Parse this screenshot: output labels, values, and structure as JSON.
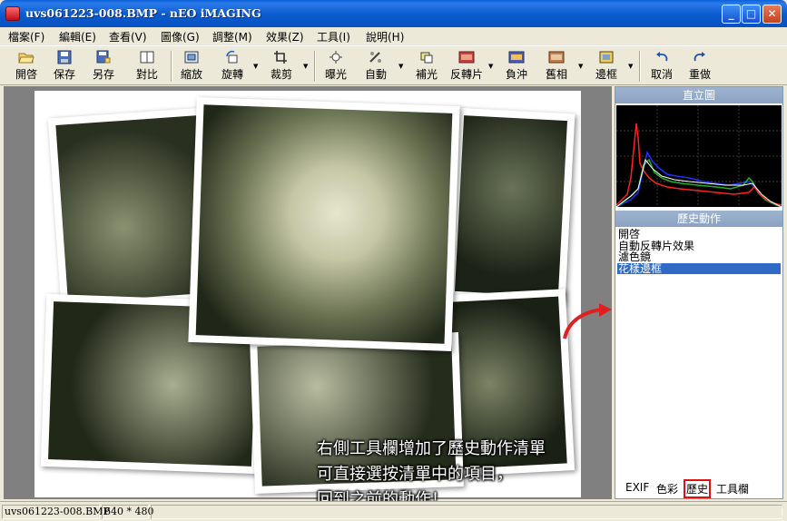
{
  "window": {
    "title": "uvs061223-008.BMP - nEO iMAGING",
    "minimize": "_",
    "maximize": "□",
    "close": "✕"
  },
  "menu": [
    "檔案(F)",
    "編輯(E)",
    "查看(V)",
    "圖像(G)",
    "調整(M)",
    "效果(Z)",
    "工具(I)",
    "說明(H)"
  ],
  "toolbar": [
    {
      "label": "開啓",
      "icon": "open-folder-icon"
    },
    {
      "label": "保存",
      "icon": "save-disk-icon"
    },
    {
      "label": "另存",
      "icon": "save-as-icon"
    },
    {
      "label": "對比",
      "icon": "compare-icon"
    },
    {
      "label": "縮放",
      "icon": "resize-icon"
    },
    {
      "label": "旋轉",
      "icon": "rotate-icon"
    },
    {
      "label": "裁剪",
      "icon": "crop-icon"
    },
    {
      "label": "曝光",
      "icon": "exposure-icon"
    },
    {
      "label": "自動",
      "icon": "auto-icon"
    },
    {
      "label": "補光",
      "icon": "fill-light-icon"
    },
    {
      "label": "反轉片",
      "icon": "reversal-film-icon"
    },
    {
      "label": "負沖",
      "icon": "cross-process-icon"
    },
    {
      "label": "舊相",
      "icon": "old-photo-icon"
    },
    {
      "label": "邊框",
      "icon": "frame-icon"
    },
    {
      "label": "取消",
      "icon": "undo-icon"
    },
    {
      "label": "重做",
      "icon": "redo-icon"
    }
  ],
  "panel": {
    "histogram_title": "直立圖",
    "history_title": "歷史動作",
    "history": [
      "開啓",
      "自動反轉片效果",
      "濾色鏡",
      "花樣邊框"
    ],
    "selected_index": 3,
    "tabs": [
      "EXIF",
      "色彩",
      "歷史",
      "工具欄"
    ],
    "active_tab": "歷史"
  },
  "caption": {
    "lines": [
      "右側工具欄增加了歷史動作清單",
      "可直接選按清單中的項目，",
      "回到之前的動作！"
    ]
  },
  "status": {
    "filename": "uvs061223-008.BMP",
    "size": "640 * 480"
  },
  "colors": {
    "titlebar": "#0A5ACE",
    "selection": "#316AC5",
    "annotation_arrow": "#e02020"
  }
}
